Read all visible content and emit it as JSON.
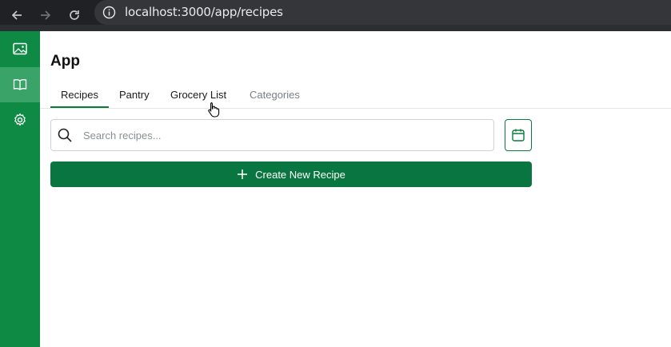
{
  "browser": {
    "url": "localhost:3000/app/recipes",
    "icons": [
      "back-arrow-icon",
      "forward-arrow-icon",
      "reload-icon",
      "info-icon"
    ]
  },
  "sidebar": {
    "items": [
      {
        "icon": "image-icon",
        "active": false
      },
      {
        "icon": "book-open-icon",
        "active": true
      },
      {
        "icon": "gear-icon",
        "active": false
      }
    ]
  },
  "header": {
    "title": "App"
  },
  "tabs": [
    {
      "label": "Recipes",
      "active": true
    },
    {
      "label": "Pantry",
      "active": false
    },
    {
      "label": "Grocery List",
      "active": false
    },
    {
      "label": "Categories",
      "active": false
    }
  ],
  "search": {
    "placeholder": "Search recipes...",
    "value": ""
  },
  "toolbar": {
    "create_label": "Create New Recipe"
  },
  "colors": {
    "brand": "#097540",
    "sidebar": "#0e8a44",
    "sidebar_active": "#3aa367",
    "browser_bg": "#202124"
  }
}
